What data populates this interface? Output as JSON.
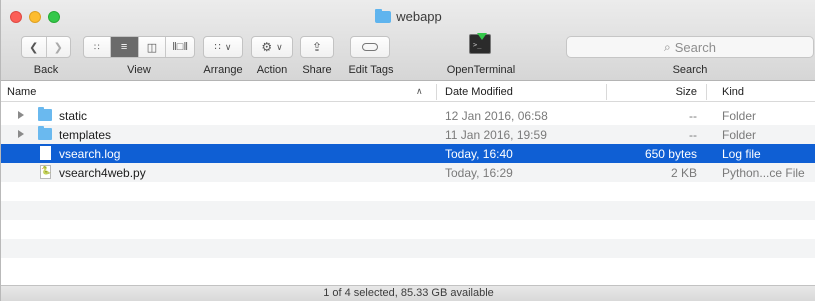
{
  "window": {
    "title": "webapp"
  },
  "toolbar": {
    "back_label": "Back",
    "view_label": "View",
    "arrange_label": "Arrange",
    "action_label": "Action",
    "share_label": "Share",
    "edit_tags_label": "Edit Tags",
    "open_terminal_label": "OpenTerminal",
    "search_label": "Search",
    "search_placeholder": "Search"
  },
  "columns": {
    "name": "Name",
    "date_modified": "Date Modified",
    "size": "Size",
    "kind": "Kind"
  },
  "files": [
    {
      "name": "static",
      "date": "12 Jan 2016, 06:58",
      "size": "--",
      "kind": "Folder",
      "type": "folder",
      "selected": false
    },
    {
      "name": "templates",
      "date": "11 Jan 2016, 19:59",
      "size": "--",
      "kind": "Folder",
      "type": "folder",
      "selected": false
    },
    {
      "name": "vsearch.log",
      "date": "Today, 16:40",
      "size": "650 bytes",
      "kind": "Log file",
      "type": "doc",
      "selected": true
    },
    {
      "name": "vsearch4web.py",
      "date": "Today, 16:29",
      "size": "2 KB",
      "kind": "Python...ce File",
      "type": "python",
      "selected": false
    }
  ],
  "status": {
    "text": "1 of 4 selected, 85.33 GB available"
  },
  "colors": {
    "selection": "#0f5fd4",
    "folder": "#6ab9ef"
  }
}
